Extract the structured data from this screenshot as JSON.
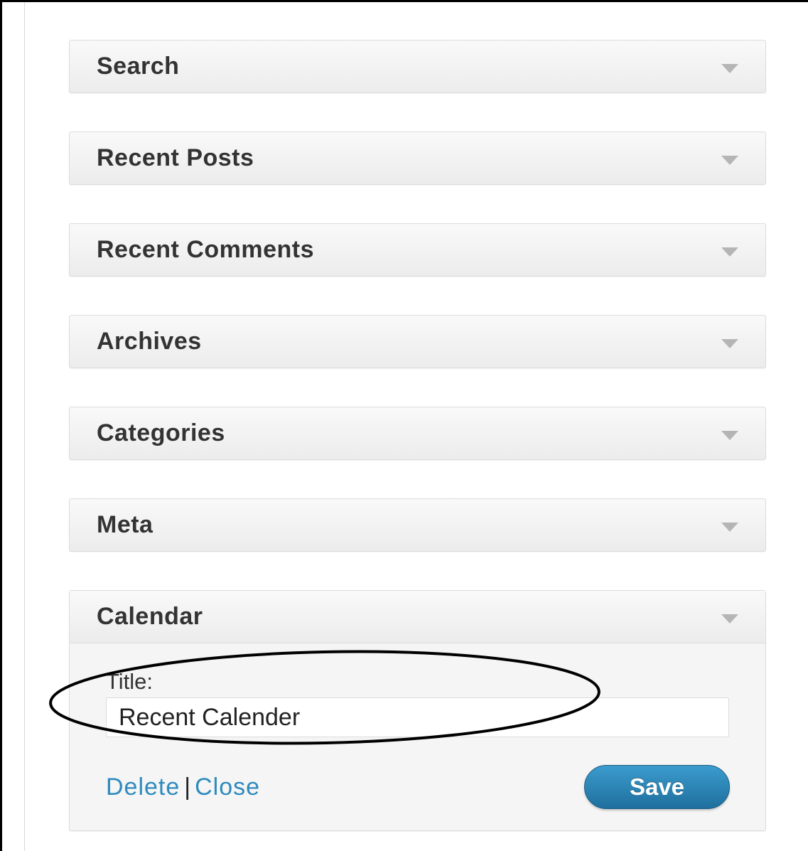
{
  "widgets": [
    {
      "title": "Search"
    },
    {
      "title": "Recent Posts"
    },
    {
      "title": "Recent Comments"
    },
    {
      "title": "Archives"
    },
    {
      "title": "Categories"
    },
    {
      "title": "Meta"
    },
    {
      "title": "Calendar"
    }
  ],
  "calendar_form": {
    "title_label": "Title:",
    "title_value": "Recent Calender",
    "delete_label": "Delete",
    "separator": "|",
    "close_label": "Close",
    "save_label": "Save"
  },
  "colors": {
    "link": "#2e8bbd",
    "save_button": "#2b86b8",
    "annotation_ellipse": "#000000"
  },
  "icons": {
    "widget_toggle": "triangle-down-icon"
  }
}
